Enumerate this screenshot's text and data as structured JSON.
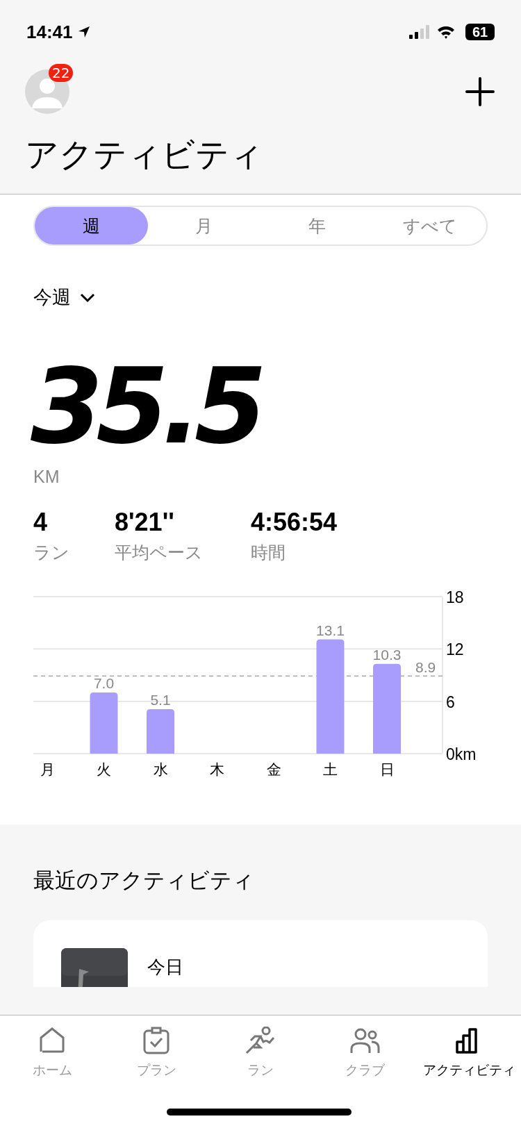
{
  "status_bar": {
    "time": "14:41",
    "battery": "61"
  },
  "header": {
    "badge": "22",
    "title": "アクティビティ"
  },
  "tabs": [
    {
      "label": "週",
      "selected": true
    },
    {
      "label": "月",
      "selected": false
    },
    {
      "label": "年",
      "selected": false
    },
    {
      "label": "すべて",
      "selected": false
    }
  ],
  "period": {
    "label": "今週"
  },
  "summary": {
    "distance": "35.5",
    "unit": "KM"
  },
  "stats": [
    {
      "value": "4",
      "label": "ラン"
    },
    {
      "value": "8'21''",
      "label": "平均ペース"
    },
    {
      "value": "4:56:54",
      "label": "時間"
    }
  ],
  "chart_data": {
    "type": "bar",
    "categories": [
      "月",
      "火",
      "水",
      "木",
      "金",
      "土",
      "日"
    ],
    "values": [
      0,
      7.0,
      5.1,
      0,
      0,
      13.1,
      10.3
    ],
    "ylim": [
      0,
      18
    ],
    "yticks": [
      {
        "value": 0,
        "label": "0km"
      },
      6,
      12,
      18
    ],
    "value_labels": [
      null,
      "7.0",
      "5.1",
      null,
      null,
      "13.1",
      "10.3"
    ],
    "ref_lines": [
      {
        "axis": "y",
        "value": 8.9,
        "label": "8.9"
      }
    ]
  },
  "recent": {
    "title": "最近のアクティビティ",
    "items": [
      {
        "kind": "picture",
        "title": "今日"
      }
    ]
  },
  "bottom_nav": [
    {
      "label": "ホーム",
      "selected": false
    },
    {
      "label": "プラン",
      "selected": false
    },
    {
      "label": "ラン",
      "selected": false
    },
    {
      "label": "クラブ",
      "selected": false
    },
    {
      "label": "アクティビティ",
      "selected": true
    }
  ]
}
